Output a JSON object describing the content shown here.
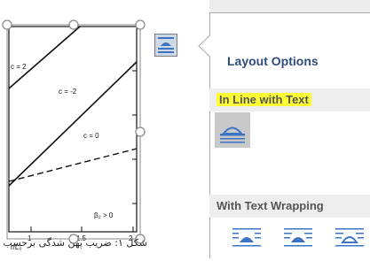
{
  "document": {
    "figure": {
      "curve_labels": [
        "c = 2",
        "c = -2",
        "c = 0"
      ],
      "beta_label": "β₂ > 0",
      "x_ticks": [
        "1",
        "1.5",
        "2"
      ],
      "x_axis_label": "r/L₀"
    },
    "caption": "شکل ۱: ضریب پهن شدگی برحسب"
  },
  "layout_options_button": {
    "icon": "layout-options-icon"
  },
  "pane": {
    "title": "Layout Options",
    "sections": [
      {
        "label": "In Line with Text",
        "highlighted": true,
        "options": [
          {
            "name": "in-line-with-text",
            "selected": true
          }
        ]
      },
      {
        "label": "With Text Wrapping",
        "options": [
          {
            "name": "square"
          },
          {
            "name": "tight"
          },
          {
            "name": "through"
          }
        ]
      }
    ]
  },
  "colors": {
    "accent": "#2f4d7b",
    "highlight": "#ffff33",
    "icon_blue": "#3b74c5"
  }
}
